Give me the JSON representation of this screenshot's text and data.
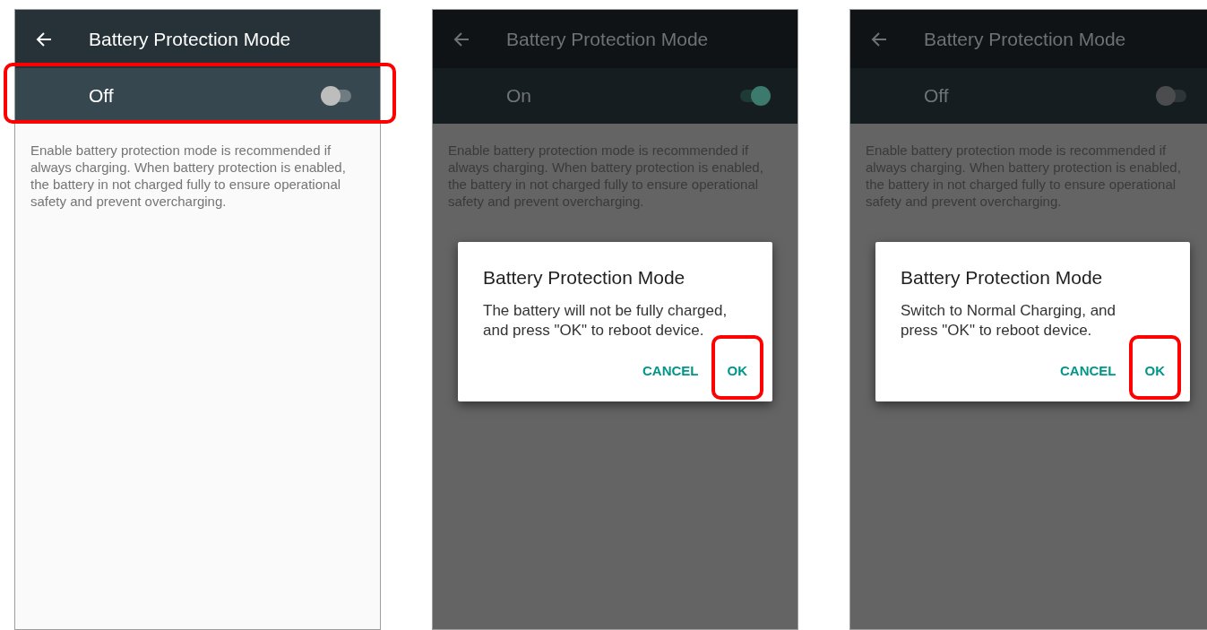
{
  "screens": [
    {
      "title": "Battery Protection Mode",
      "dimmed": false,
      "switch": {
        "label": "Off",
        "on": false,
        "highlighted": true
      },
      "description": "Enable battery protection mode is recommended if always charging. When battery protection is enabled, the battery in not charged fully to ensure operational safety and prevent overcharging."
    },
    {
      "title": "Battery Protection Mode",
      "dimmed": true,
      "switch": {
        "label": "On",
        "on": true,
        "highlighted": false
      },
      "description": "Enable battery protection mode is recommended if always charging. When battery protection is enabled, the battery in not charged fully to ensure operational safety and prevent overcharging.",
      "dialog": {
        "title": "Battery Protection Mode",
        "message": "The battery will not be fully charged, and press \"OK\" to reboot device.",
        "buttons": [
          {
            "label": "CANCEL",
            "highlighted": false
          },
          {
            "label": "OK",
            "highlighted": true
          }
        ]
      }
    },
    {
      "title": "Battery Protection Mode",
      "dimmed": true,
      "switch": {
        "label": "Off",
        "on": false,
        "highlighted": false
      },
      "description": "Enable battery protection mode is recommended if always charging. When battery protection is enabled, the battery in not charged fully to ensure operational safety and prevent overcharging.",
      "dialog": {
        "title": "Battery Protection Mode",
        "message": "Switch to Normal Charging, and press \"OK\" to reboot device.",
        "buttons": [
          {
            "label": "CANCEL",
            "highlighted": false
          },
          {
            "label": "OK",
            "highlighted": true
          }
        ]
      }
    }
  ]
}
